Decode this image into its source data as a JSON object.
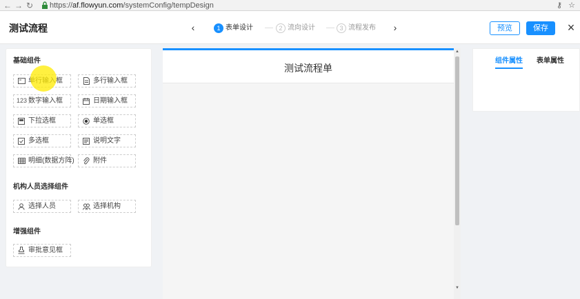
{
  "browser": {
    "url_scheme": "https://",
    "url_host": "af.flowyun.com",
    "url_path": "/systemConfig/tempDesign"
  },
  "header": {
    "title": "测试流程",
    "steps": [
      {
        "num": "1",
        "label": "表单设计",
        "active": true
      },
      {
        "num": "2",
        "label": "流向设计",
        "active": false
      },
      {
        "num": "3",
        "label": "流程发布",
        "active": false
      }
    ],
    "prev_arrow": "‹",
    "next_arrow": "›",
    "preview_label": "预览",
    "save_label": "保存",
    "close_label": "×"
  },
  "left_panel": {
    "basic": {
      "title": "基础组件",
      "items": [
        {
          "label": "单行输入框",
          "icon": "input-icon"
        },
        {
          "label": "多行输入框",
          "icon": "textarea-icon"
        },
        {
          "label": "数字输入框",
          "icon": "number-icon",
          "icon_text": "123"
        },
        {
          "label": "日期输入框",
          "icon": "calendar-icon"
        },
        {
          "label": "下拉选框",
          "icon": "dropdown-icon"
        },
        {
          "label": "单选框",
          "icon": "radio-icon"
        },
        {
          "label": "多选框",
          "icon": "checkbox-icon"
        },
        {
          "label": "说明文字",
          "icon": "note-icon"
        },
        {
          "label": "明细(数据方阵)",
          "icon": "table-icon"
        },
        {
          "label": "附件",
          "icon": "paperclip-icon"
        }
      ]
    },
    "org": {
      "title": "机构人员选择组件",
      "items": [
        {
          "label": "选择人员",
          "icon": "user-icon"
        },
        {
          "label": "选择机构",
          "icon": "org-icon"
        }
      ]
    },
    "enhanced": {
      "title": "增强组件",
      "items": [
        {
          "label": "审批意见框",
          "icon": "stamp-icon"
        }
      ]
    }
  },
  "canvas": {
    "form_title": "测试流程单"
  },
  "right_panel": {
    "tabs": [
      {
        "label": "组件属性",
        "active": true
      },
      {
        "label": "表单属性",
        "active": false
      }
    ]
  },
  "colors": {
    "accent": "#1890ff",
    "cursor_highlight": "#ffeb00"
  }
}
